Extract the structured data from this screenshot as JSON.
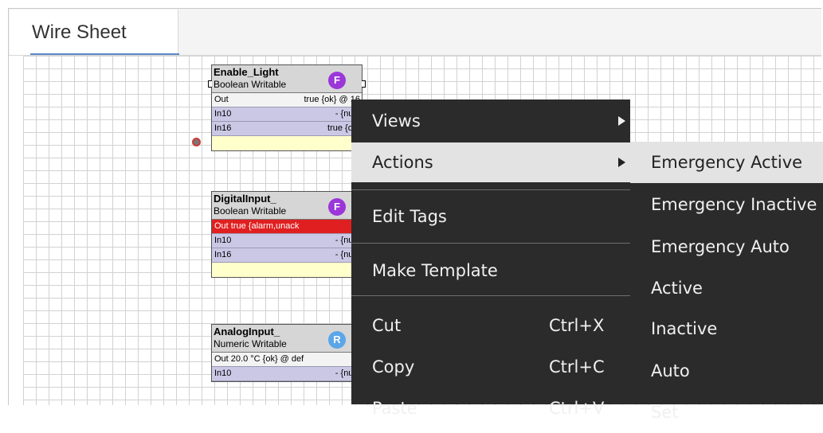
{
  "tab": {
    "label": "Wire Sheet"
  },
  "nodes": [
    {
      "name": "Enable_Light",
      "type": "Boolean Writable",
      "badge": "F",
      "rows": [
        {
          "label": "Out",
          "value": "true {ok} @ 16",
          "kind": "out"
        },
        {
          "label": "In10",
          "value": "- {null}"
        },
        {
          "label": "In16",
          "value": "true {ok}"
        }
      ]
    },
    {
      "name": "DigitalInput_",
      "type": "Boolean Writable",
      "badge": "F",
      "rows": [
        {
          "label": "Out true {alarm,unack",
          "kind": "alarm"
        },
        {
          "label": "In10",
          "value": "- {null}"
        },
        {
          "label": "In16",
          "value": "- {null}"
        }
      ]
    },
    {
      "name": "AnalogInput_",
      "type": "Numeric Writable",
      "badge": "R",
      "rows": [
        {
          "label": "Out 20.0 °C {ok} @ def",
          "kind": "out"
        },
        {
          "label": "In10",
          "value": "- {null}"
        }
      ]
    }
  ],
  "context_menu": {
    "views": "Views",
    "actions": "Actions",
    "edit_tags": "Edit Tags",
    "make_template": "Make Template",
    "cut": "Cut",
    "cut_shortcut": "Ctrl+X",
    "copy": "Copy",
    "copy_shortcut": "Ctrl+C",
    "paste": "Paste",
    "paste_shortcut": "Ctrl+V"
  },
  "actions_submenu": [
    "Emergency Active",
    "Emergency Inactive",
    "Emergency Auto",
    "Active",
    "Inactive",
    "Auto",
    "Set"
  ],
  "colors": {
    "menu_bg": "#2b2b2b",
    "menu_hover": "#e3e3e3",
    "badge_f": "#9b36d9",
    "badge_r": "#5aa6e8",
    "alarm": "#e02020"
  }
}
